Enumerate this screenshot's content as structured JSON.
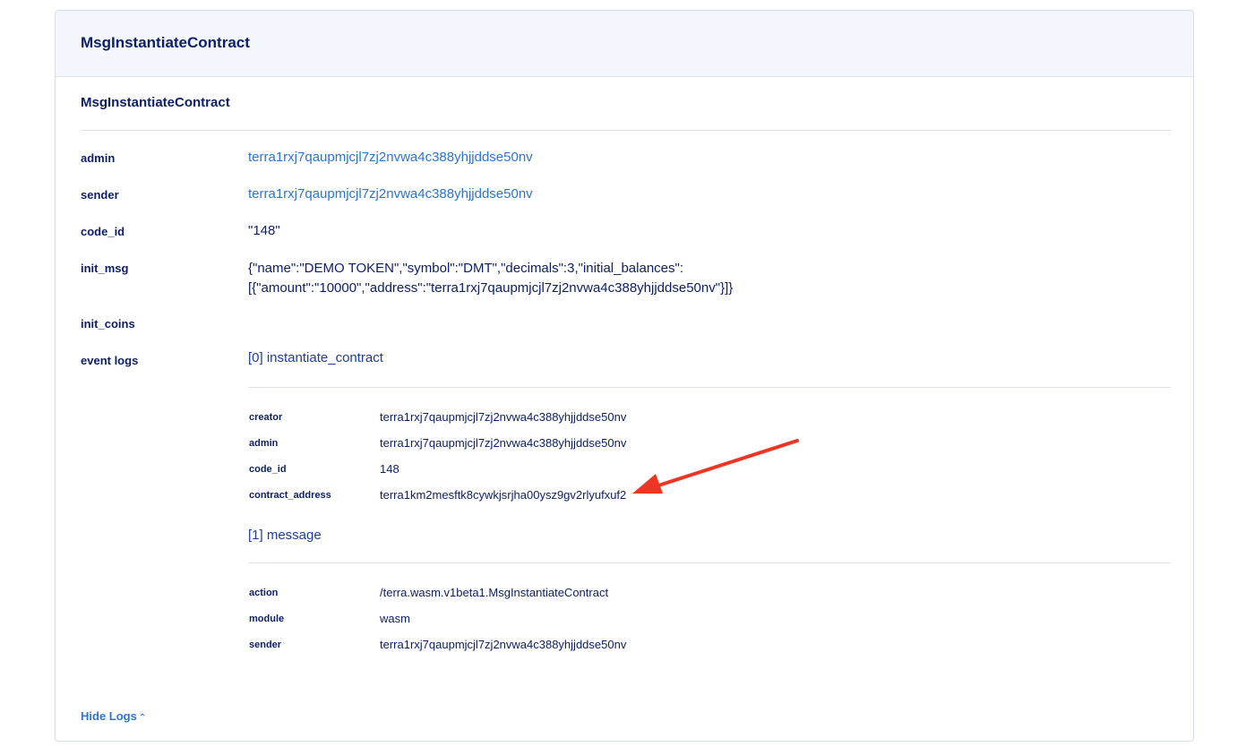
{
  "card": {
    "title": "MsgInstantiateContract",
    "section_title": "MsgInstantiateContract"
  },
  "fields": {
    "admin_label": "admin",
    "admin_value": "terra1rxj7qaupmjcjl7zj2nvwa4c388yhjjddse50nv",
    "sender_label": "sender",
    "sender_value": "terra1rxj7qaupmjcjl7zj2nvwa4c388yhjjddse50nv",
    "code_id_label": "code_id",
    "code_id_value": "\"148\"",
    "init_msg_label": "init_msg",
    "init_msg_line1": "{\"name\":\"DEMO TOKEN\",\"symbol\":\"DMT\",\"decimals\":3,\"initial_balances\":",
    "init_msg_line2": "[{\"amount\":\"10000\",\"address\":\"terra1rxj7qaupmjcjl7zj2nvwa4c388yhjjddse50nv\"}]}",
    "init_coins_label": "init_coins",
    "event_logs_label": "event logs"
  },
  "logs": [
    {
      "header": "[0] instantiate_contract",
      "attributes": [
        {
          "key": "creator",
          "value": "terra1rxj7qaupmjcjl7zj2nvwa4c388yhjjddse50nv"
        },
        {
          "key": "admin",
          "value": "terra1rxj7qaupmjcjl7zj2nvwa4c388yhjjddse50nv"
        },
        {
          "key": "code_id",
          "value": "148"
        },
        {
          "key": "contract_address",
          "value": "terra1km2mesftk8cywkjsrjha00ysz9gv2rlyufxuf2"
        }
      ]
    },
    {
      "header": "[1] message",
      "attributes": [
        {
          "key": "action",
          "value": "/terra.wasm.v1beta1.MsgInstantiateContract"
        },
        {
          "key": "module",
          "value": "wasm"
        },
        {
          "key": "sender",
          "value": "terra1rxj7qaupmjcjl7zj2nvwa4c388yhjjddse50nv"
        }
      ]
    }
  ],
  "footer": {
    "hide_logs_label": "Hide Logs",
    "chevron_icon": "chevron-up-icon"
  },
  "annotation": {
    "arrow_color": "#ee3523",
    "arrow_icon": "annotation-arrow-icon"
  },
  "colors": {
    "link": "#2b74d8",
    "text": "#0b1e6b",
    "header_bg": "#f3f6fc"
  }
}
